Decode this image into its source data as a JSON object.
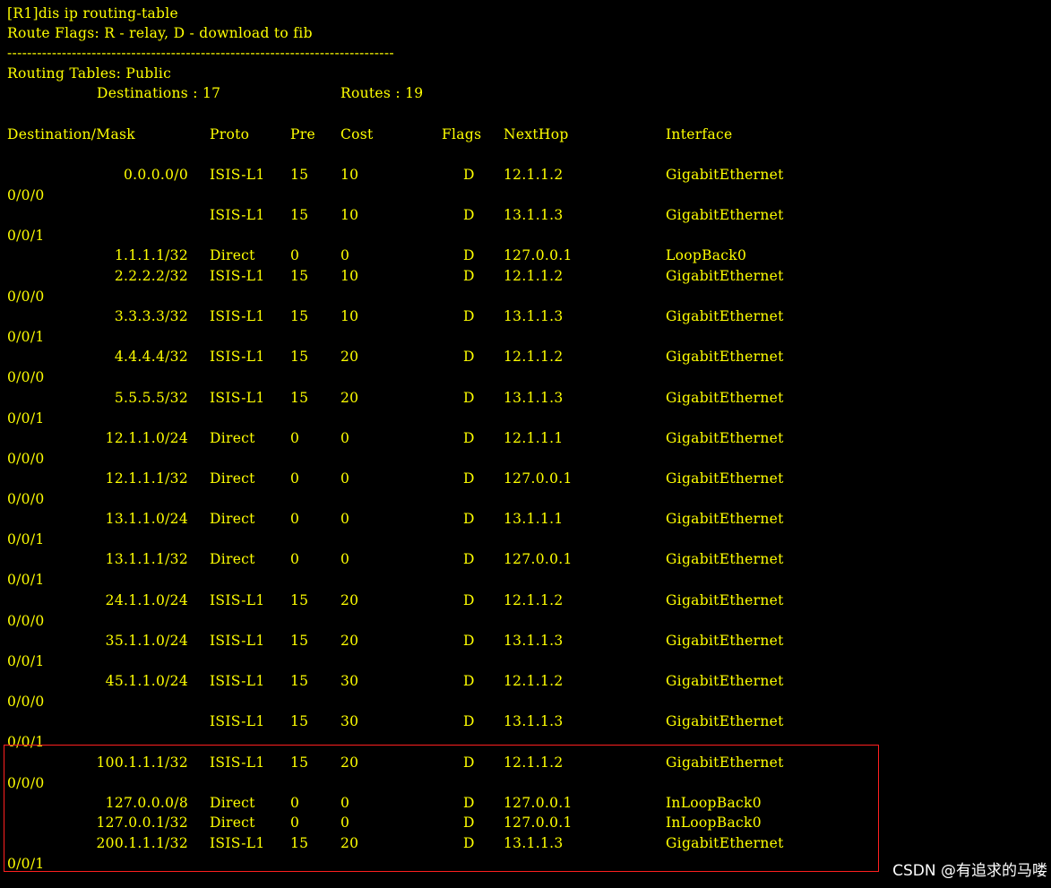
{
  "terminal": {
    "colors": {
      "background": "#000000",
      "text": "#ffff00",
      "highlight": "#ff2020",
      "watermark": "#ffffff"
    },
    "command": "[R1]dis ip routing-table",
    "flags_line": "Route Flags: R - relay, D - download to fib",
    "separator": "------------------------------------------------------------------------------",
    "tables_line": "Routing Tables: Public",
    "destinations_label": "Destinations : 17",
    "routes_label": "Routes : 19",
    "headers": {
      "destination": "Destination/Mask",
      "proto": "Proto",
      "pre": "Pre",
      "cost": "Cost",
      "flags": "Flags",
      "nexthop": "NextHop",
      "interface": "Interface"
    },
    "routes": [
      {
        "dest": "0.0.0.0/0",
        "proto": "ISIS-L1",
        "pre": "15",
        "cost": "10",
        "flags": "D",
        "nexthop": "12.1.1.2",
        "iface": "GigabitEthernet",
        "cont": "0/0/0"
      },
      {
        "dest": "",
        "proto": "ISIS-L1",
        "pre": "15",
        "cost": "10",
        "flags": "D",
        "nexthop": "13.1.1.3",
        "iface": "GigabitEthernet",
        "cont": "0/0/1"
      },
      {
        "dest": "1.1.1.1/32",
        "proto": "Direct",
        "pre": "0",
        "cost": "0",
        "flags": "D",
        "nexthop": "127.0.0.1",
        "iface": "LoopBack0",
        "cont": ""
      },
      {
        "dest": "2.2.2.2/32",
        "proto": "ISIS-L1",
        "pre": "15",
        "cost": "10",
        "flags": "D",
        "nexthop": "12.1.1.2",
        "iface": "GigabitEthernet",
        "cont": "0/0/0"
      },
      {
        "dest": "3.3.3.3/32",
        "proto": "ISIS-L1",
        "pre": "15",
        "cost": "10",
        "flags": "D",
        "nexthop": "13.1.1.3",
        "iface": "GigabitEthernet",
        "cont": "0/0/1"
      },
      {
        "dest": "4.4.4.4/32",
        "proto": "ISIS-L1",
        "pre": "15",
        "cost": "20",
        "flags": "D",
        "nexthop": "12.1.1.2",
        "iface": "GigabitEthernet",
        "cont": "0/0/0"
      },
      {
        "dest": "5.5.5.5/32",
        "proto": "ISIS-L1",
        "pre": "15",
        "cost": "20",
        "flags": "D",
        "nexthop": "13.1.1.3",
        "iface": "GigabitEthernet",
        "cont": "0/0/1"
      },
      {
        "dest": "12.1.1.0/24",
        "proto": "Direct",
        "pre": "0",
        "cost": "0",
        "flags": "D",
        "nexthop": "12.1.1.1",
        "iface": "GigabitEthernet",
        "cont": "0/0/0"
      },
      {
        "dest": "12.1.1.1/32",
        "proto": "Direct",
        "pre": "0",
        "cost": "0",
        "flags": "D",
        "nexthop": "127.0.0.1",
        "iface": "GigabitEthernet",
        "cont": "0/0/0"
      },
      {
        "dest": "13.1.1.0/24",
        "proto": "Direct",
        "pre": "0",
        "cost": "0",
        "flags": "D",
        "nexthop": "13.1.1.1",
        "iface": "GigabitEthernet",
        "cont": "0/0/1"
      },
      {
        "dest": "13.1.1.1/32",
        "proto": "Direct",
        "pre": "0",
        "cost": "0",
        "flags": "D",
        "nexthop": "127.0.0.1",
        "iface": "GigabitEthernet",
        "cont": "0/0/1"
      },
      {
        "dest": "24.1.1.0/24",
        "proto": "ISIS-L1",
        "pre": "15",
        "cost": "20",
        "flags": "D",
        "nexthop": "12.1.1.2",
        "iface": "GigabitEthernet",
        "cont": "0/0/0"
      },
      {
        "dest": "35.1.1.0/24",
        "proto": "ISIS-L1",
        "pre": "15",
        "cost": "20",
        "flags": "D",
        "nexthop": "13.1.1.3",
        "iface": "GigabitEthernet",
        "cont": "0/0/1"
      },
      {
        "dest": "45.1.1.0/24",
        "proto": "ISIS-L1",
        "pre": "15",
        "cost": "30",
        "flags": "D",
        "nexthop": "12.1.1.2",
        "iface": "GigabitEthernet",
        "cont": "0/0/0"
      },
      {
        "dest": "",
        "proto": "ISIS-L1",
        "pre": "15",
        "cost": "30",
        "flags": "D",
        "nexthop": "13.1.1.3",
        "iface": "GigabitEthernet",
        "cont": "0/0/1"
      },
      {
        "dest": "100.1.1.1/32",
        "proto": "ISIS-L1",
        "pre": "15",
        "cost": "20",
        "flags": "D",
        "nexthop": "12.1.1.2",
        "iface": "GigabitEthernet",
        "cont": "0/0/0"
      },
      {
        "dest": "127.0.0.0/8",
        "proto": "Direct",
        "pre": "0",
        "cost": "0",
        "flags": "D",
        "nexthop": "127.0.0.1",
        "iface": "InLoopBack0",
        "cont": ""
      },
      {
        "dest": "127.0.0.1/32",
        "proto": "Direct",
        "pre": "0",
        "cost": "0",
        "flags": "D",
        "nexthop": "127.0.0.1",
        "iface": "InLoopBack0",
        "cont": ""
      },
      {
        "dest": "200.1.1.1/32",
        "proto": "ISIS-L1",
        "pre": "15",
        "cost": "20",
        "flags": "D",
        "nexthop": "13.1.1.3",
        "iface": "GigabitEthernet",
        "cont": "0/0/1"
      }
    ]
  },
  "watermark": "CSDN @有追求的马喽"
}
